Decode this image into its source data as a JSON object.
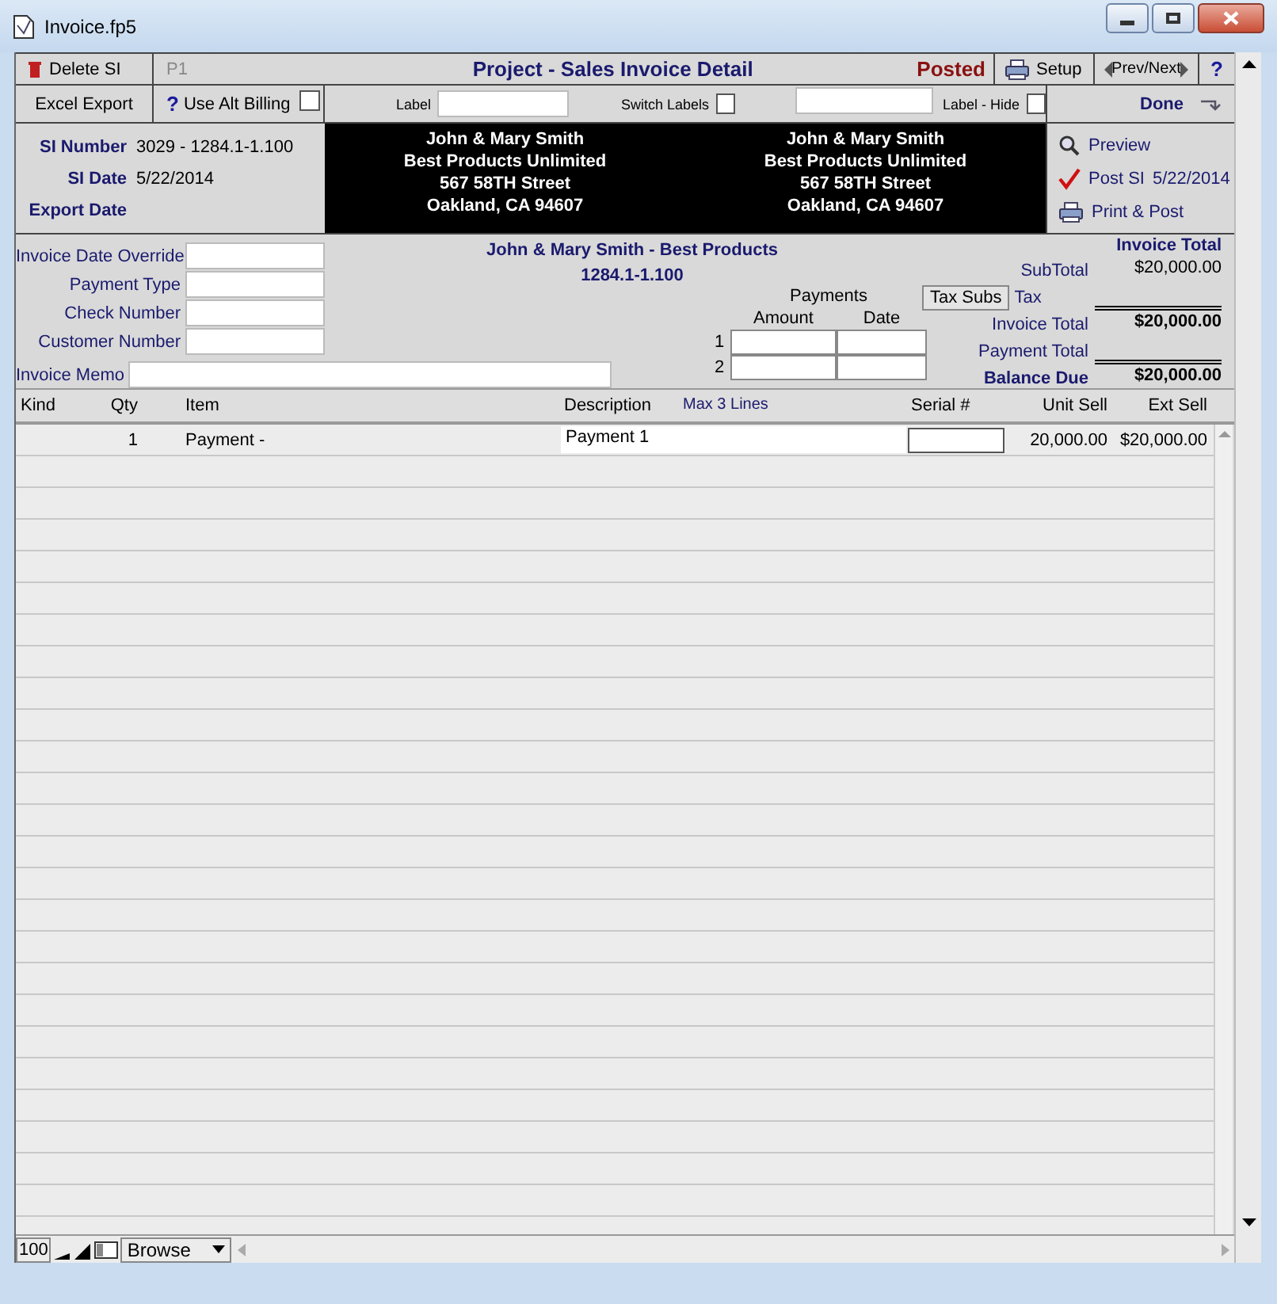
{
  "window": {
    "title": "Invoice.fp5"
  },
  "toolbar": {
    "delete_button": "Delete SI",
    "page": "P1",
    "title": "Project - Sales Invoice Detail",
    "status": "Posted",
    "setup_button": "Setup",
    "prev_next_button": "Prev/Next",
    "help_button": "?",
    "excel_export_button": "Excel Export",
    "alt_billing": {
      "icon": "?",
      "label": "Use Alt Billing",
      "checked": false
    },
    "label_field": {
      "label": "Label"
    },
    "switch_labels": {
      "label": "Switch Labels",
      "checked": false
    },
    "label_hide": {
      "label": "Label - Hide",
      "checked": false
    },
    "done_button": "Done"
  },
  "header": {
    "fields": [
      {
        "label": "SI Number",
        "value": "3029 - 1284.1-1.100"
      },
      {
        "label": "SI Date",
        "value": "5/22/2014"
      },
      {
        "label": "Export Date"
      }
    ],
    "addresses": [
      [
        "John & Mary Smith",
        "Best Products Unlimited",
        "567 58TH Street",
        "Oakland, CA 94607"
      ],
      [
        "John & Mary Smith",
        "Best Products Unlimited",
        "567 58TH Street",
        "Oakland, CA 94607"
      ]
    ],
    "actions": [
      {
        "kind": "preview",
        "label": "Preview"
      },
      {
        "kind": "post",
        "label": "Post SI",
        "date": "5/22/2014"
      },
      {
        "kind": "print",
        "label": "Print & Post"
      }
    ]
  },
  "form": {
    "fields": [
      "Invoice Date Override",
      "Payment Type",
      "Check Number",
      "Customer Number"
    ],
    "memo": "Invoice Memo",
    "customer_title": "John & Mary Smith - Best Products",
    "project_number": "1284.1-1.100",
    "payments": {
      "title": "Payments",
      "columns": [
        "Amount",
        "Date"
      ],
      "rows": [
        "1",
        "2"
      ]
    },
    "totals": {
      "title": "Invoice Total",
      "tax_subs_button": "Tax Subs",
      "lines": [
        {
          "label": "SubTotal",
          "value": "$20,000.00",
          "label_bold": false,
          "value_bold": false,
          "rule": false
        },
        {
          "label": "Tax",
          "label_bold": false,
          "rule": true
        },
        {
          "label": "Invoice Total",
          "value": "$20,000.00",
          "label_bold": false,
          "value_bold": true,
          "rule": false
        },
        {
          "label": "Payment Total",
          "label_bold": false,
          "rule": true
        },
        {
          "label": "Balance Due",
          "value": "$20,000.00",
          "label_bold": true,
          "value_bold": true,
          "rule": false
        }
      ]
    }
  },
  "table": {
    "columns": [
      "Kind",
      "Qty",
      "Item",
      "Description",
      "Max 3 Lines",
      "Serial #",
      "Unit Sell",
      "Ext Sell"
    ],
    "rows": [
      {
        "qty": "1",
        "item": "Payment -",
        "description": "Payment 1",
        "unit_sell": "20,000.00",
        "ext_sell": "$20,000.00"
      }
    ]
  },
  "status_bar": {
    "zoom": "100",
    "mode": "Browse"
  }
}
